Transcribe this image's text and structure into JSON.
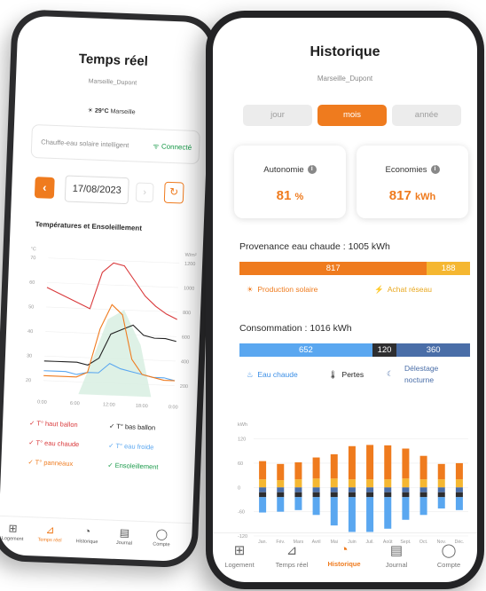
{
  "colors": {
    "accent": "#ef7b1e",
    "solar": "#f5b731",
    "blue": "#5aa7f0",
    "dark": "#2e2e30",
    "navy": "#4a6ea8",
    "green": "#1a9a4a"
  },
  "back_screen": {
    "title": "Temps réel",
    "subtitle": "Marseille_Dupont",
    "weather": "29°C",
    "weather_city": "Marseille",
    "device_label": "Chauffe-eau solaire intelligent",
    "status": "Connecté",
    "date": "17/08/2023",
    "chart_title": "Températures et Ensoleillement",
    "y_left_unit": "°C",
    "y_right_unit": "W/m²",
    "y_left_ticks": [
      "70",
      "60",
      "50",
      "40",
      "30",
      "20"
    ],
    "y_right_ticks": [
      "1200",
      "1000",
      "800",
      "600",
      "400",
      "200"
    ],
    "x_ticks": [
      "0:00",
      "6:00",
      "12:00",
      "18:00",
      "0:00"
    ],
    "legend": [
      {
        "label": "T° haut ballon",
        "color": "#d9393b"
      },
      {
        "label": "T° bas ballon",
        "color": "#222222"
      },
      {
        "label": "T° eau chaude",
        "color": "#d9393b"
      },
      {
        "label": "T° eau froide",
        "color": "#5aa7f0"
      },
      {
        "label": "T° panneaux",
        "color": "#ef7b1e"
      },
      {
        "label": "Ensoleillement",
        "color": "#1a9a4a"
      }
    ],
    "nav": [
      "Logement",
      "Temps réel",
      "Historique",
      "Journal",
      "Compte"
    ],
    "active_nav": "Temps réel"
  },
  "front_screen": {
    "title": "Historique",
    "subtitle": "Marseille_Dupont",
    "tabs": [
      "jour",
      "mois",
      "année"
    ],
    "active_tab": "mois",
    "autonomy": {
      "label": "Autonomie",
      "value": "81",
      "unit": "%"
    },
    "economies": {
      "label": "Economies",
      "value": "817",
      "unit": "kWh"
    },
    "provenance_title": "Provenance eau chaude : 1005 kWh",
    "provenance_bar": [
      {
        "label": "817",
        "value": 817,
        "color": "#ef7b1e"
      },
      {
        "label": "188",
        "value": 188,
        "color": "#f5b731"
      }
    ],
    "provenance_legend": [
      "Production solaire",
      "Achat réseau"
    ],
    "consumption_title": "Consommation : 1016 kWh",
    "consumption_bar": [
      {
        "label": "652",
        "value": 652,
        "color": "#5aa7f0"
      },
      {
        "label": "120",
        "value": 120,
        "color": "#2e2e30"
      },
      {
        "label": "360",
        "value": 360,
        "color": "#4a6ea8"
      }
    ],
    "consumption_legend": [
      "Eau chaude",
      "Pertes",
      "Délestage",
      "nocturne"
    ],
    "nav": [
      "Logement",
      "Temps réel",
      "Historique",
      "Journal",
      "Compte"
    ],
    "active_nav": "Historique"
  },
  "chart_data": [
    {
      "type": "bar",
      "ylabel": "kWh",
      "ylim": [
        -120,
        130
      ],
      "yticks": [
        120,
        60,
        0,
        -60,
        -120
      ],
      "categories": [
        "Jan.",
        "Fév.",
        "Mars",
        "Avril",
        "Mai",
        "Juin",
        "Juil.",
        "Août",
        "Sept.",
        "Oct.",
        "Nov.",
        "Déc."
      ],
      "series": [
        {
          "values": [
            20,
            18,
            20,
            22,
            22,
            20,
            20,
            20,
            22,
            20,
            20,
            20
          ],
          "color": "#f5b731"
        },
        {
          "values": [
            45,
            40,
            42,
            52,
            60,
            82,
            85,
            84,
            74,
            58,
            38,
            40
          ],
          "color": "#ef7b1e"
        },
        {
          "values": [
            -12,
            -12,
            -12,
            -12,
            -12,
            -12,
            -12,
            -12,
            -12,
            -12,
            -12,
            -12
          ],
          "color": "#4a6ea8"
        },
        {
          "values": [
            -12,
            -12,
            -12,
            -12,
            -12,
            -12,
            -12,
            -12,
            -12,
            -12,
            -12,
            -12
          ],
          "color": "#2e2e30"
        },
        {
          "values": [
            -38,
            -36,
            -32,
            -44,
            -70,
            -86,
            -86,
            -78,
            -56,
            -44,
            -28,
            -32
          ],
          "color": "#5aa7f0"
        }
      ]
    },
    {
      "type": "line",
      "x": [
        0,
        2,
        4,
        6,
        8,
        10,
        12,
        14,
        16,
        18,
        20,
        22,
        24
      ],
      "series": [
        {
          "values": [
            58,
            56,
            54,
            52,
            50,
            65,
            69,
            68,
            62,
            56,
            52,
            49,
            47
          ],
          "color": "#d9393b"
        },
        {
          "values": [
            28,
            28,
            28,
            28,
            27,
            30,
            40,
            42,
            44,
            40,
            39,
            39,
            38
          ],
          "color": "#222222"
        },
        {
          "values": [
            24,
            24,
            24,
            23,
            24,
            24,
            28,
            26,
            25,
            24,
            23,
            23,
            22
          ],
          "color": "#5aa7f0"
        },
        {
          "values": [
            22,
            22,
            22,
            22,
            24,
            42,
            52,
            48,
            30,
            24,
            23,
            22,
            22
          ],
          "color": "#ef7b1e"
        }
      ]
    }
  ]
}
